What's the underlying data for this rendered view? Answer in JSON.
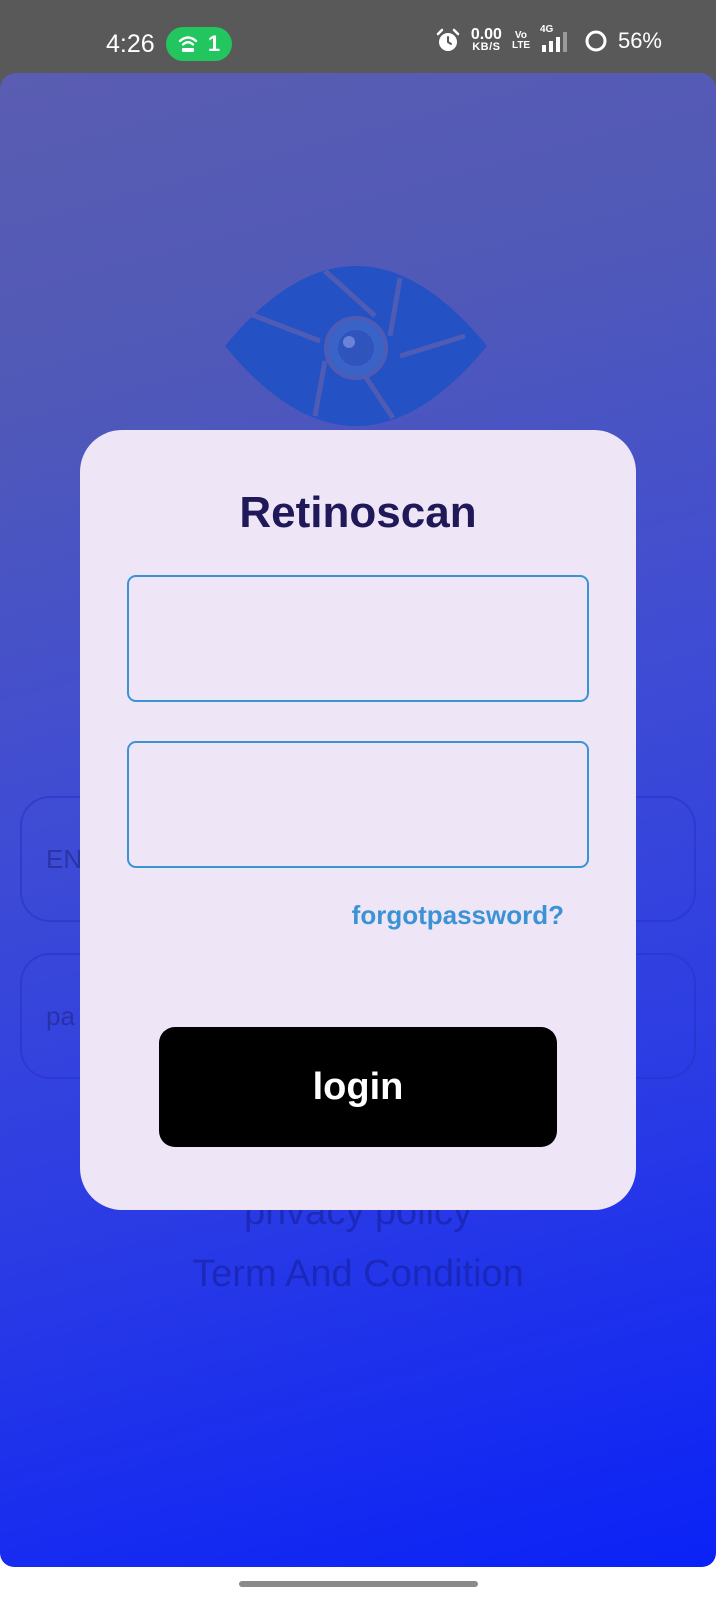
{
  "status_bar": {
    "time": "4:26",
    "hotspot_count": "1",
    "net_speed_value": "0.00",
    "net_speed_unit": "KB/S",
    "volte_top": "Vo",
    "volte_bottom": "LTE",
    "network_type": "4G",
    "battery": "56%",
    "icons": [
      "hotspot-icon",
      "alarm-icon",
      "signal-icon",
      "battery-icon"
    ]
  },
  "background": {
    "email_placeholder_partial": "EN",
    "password_placeholder_partial": "pa",
    "privacy_link": "privacy policy",
    "terms_link": "Term And Condition"
  },
  "dialog": {
    "title": "Retinoscan",
    "email_value": "",
    "password_value": "",
    "forgot_password": "forgotpassword?",
    "login_button": "login"
  },
  "colors": {
    "status_bar": "#595959",
    "hotspot_pill": "#22c55e",
    "gradient_top": "#5a5db1",
    "gradient_bottom": "#0a22f7",
    "card_background": "#eee6f6",
    "title": "#1f1859",
    "accent": "#3b93d6",
    "button": "#000000"
  }
}
